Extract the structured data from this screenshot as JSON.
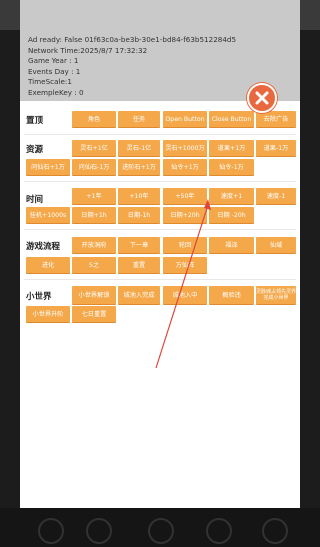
{
  "debug_info": {
    "ad_ready": "Ad ready: False  01f63c0a-be3b-30e1-bd84-f63b512284d5",
    "network_time": "Network Time:2025/8/7 17:32:32",
    "game_year": "Game Year : 1",
    "events_day": "Events Day : 1",
    "time_scale": "TimeScale:1",
    "example_key": "ExempleKey : 0"
  },
  "close_button": {
    "icon": "close-x-icon"
  },
  "sections": {
    "settop": {
      "label": "置顶",
      "buttons": [
        "角色",
        "任务",
        "Open Button",
        "Close Button",
        "去除广告"
      ]
    },
    "resource": {
      "label": "资源",
      "buttons": [
        "灵石+1亿",
        "灵石-1亿",
        "灵石+1000万",
        "道果+1万",
        "道果-1万",
        "问仙石+1万",
        "问仙石-1万",
        "进阶石+1万",
        "仙令+1万",
        "仙令-1万"
      ]
    },
    "time": {
      "label": "时间",
      "buttons": [
        "+1年",
        "+10年",
        "+50年",
        "速度+1",
        "速度-1",
        "挂机+1000s",
        "日期+1h",
        "日期-1h",
        "日期+20h",
        "日期 -20h"
      ]
    },
    "flow": {
      "label": "游戏流程",
      "buttons": [
        "开放洞府",
        "下一章",
        "轮回",
        "福泽",
        "仙域",
        "进化",
        "5之",
        "重置",
        "万仙阵"
      ]
    },
    "small_world": {
      "label": "小世界",
      "buttons": [
        "小世界解锁",
        "城池入完成",
        "城池入中",
        "概验违",
        "灵脉城占领先灵界完成小世界",
        "小世界升阶",
        "七日重置"
      ]
    }
  },
  "colors": {
    "button_bg": "#f4a84a",
    "close_bg": "#e8693f",
    "annotation_line": "#e0453a"
  }
}
